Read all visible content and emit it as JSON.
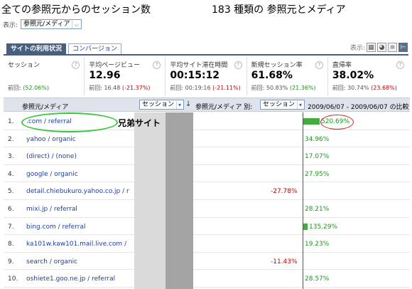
{
  "title": {
    "text": "全ての参照元からのセッション数",
    "count_text": "183 種類の 参照元とメディア"
  },
  "display": {
    "label": "表示:",
    "selected": "参照元/メディア"
  },
  "tabs": [
    {
      "label": "サイトの利用状況",
      "active": true
    },
    {
      "label": "コンバージョン",
      "active": false
    }
  ],
  "view_label": "表示:",
  "metrics": [
    {
      "label": "セッション",
      "value": "",
      "prev_label": "前回:",
      "prev_value": "",
      "change": "(52.06%)",
      "change_sign": "pos"
    },
    {
      "label": "平均ページビュー",
      "value": "12.96",
      "prev_label": "前回:",
      "prev_value": "16.48",
      "change": "(-21.37%)",
      "change_sign": "neg"
    },
    {
      "label": "平均サイト滞在時間",
      "value": "00:15:12",
      "prev_label": "前回:",
      "prev_value": "00:19:16",
      "change": "(-21.11%)",
      "change_sign": "neg"
    },
    {
      "label": "新規セッション率",
      "value": "61.68%",
      "prev_label": "前回:",
      "prev_value": "50.83%",
      "change": "(21.36%)",
      "change_sign": "pos"
    },
    {
      "label": "直帰率",
      "value": "38.02%",
      "prev_label": "前回:",
      "prev_value": "30.74%",
      "change": "(23.68%)",
      "change_sign": "pos"
    }
  ],
  "table": {
    "dimension_header": "参照元/メディア",
    "metric_select": "セッション",
    "by_label": "参照元/メディア 別:",
    "by_select": "セッション",
    "range_label": "2009/06/07 - 2009/06/07 の比較",
    "rows": [
      {
        "num": "1.",
        "source": ".com / referral",
        "change": "520.69%",
        "value": 520.69
      },
      {
        "num": "2.",
        "source": "yahoo / organic",
        "change": "34.96%",
        "value": 34.96
      },
      {
        "num": "3.",
        "source": "(direct) / (none)",
        "change": "17.07%",
        "value": 17.07
      },
      {
        "num": "4.",
        "source": "google / organic",
        "change": "27.95%",
        "value": 27.95
      },
      {
        "num": "5.",
        "source": "detail.chiebukuro.yahoo.co.jp / r",
        "change": "-27.78%",
        "value": -27.78
      },
      {
        "num": "6.",
        "source": "mixi.jp / referral",
        "change": "28.21%",
        "value": 28.21
      },
      {
        "num": "7.",
        "source": "bing.com / referral",
        "change": "135.29%",
        "value": 135.29
      },
      {
        "num": "8.",
        "source": "ka101w.kaw101.mail.live.com /",
        "change": "19.23%",
        "value": 19.23
      },
      {
        "num": "9.",
        "source": "search / organic",
        "change": "-11.43%",
        "value": -11.43
      },
      {
        "num": "10.",
        "source": "oshiete1.goo.ne.jp / referral",
        "change": "28.57%",
        "value": 28.57
      }
    ]
  },
  "annotation": {
    "text": "兄弟サイト"
  },
  "colors": {
    "positive": "#1a9a1a",
    "negative": "#cc0000",
    "bar": "#3fae3f",
    "tab_active": "#47607f",
    "link": "#1f3fa0"
  }
}
